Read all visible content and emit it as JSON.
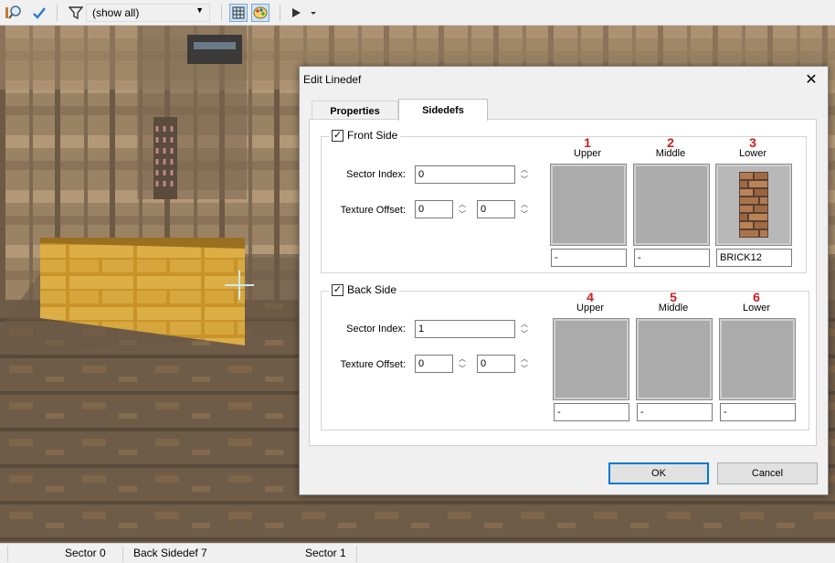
{
  "toolbar": {
    "filter_value": "(show all)",
    "icons": [
      "zoom-icon",
      "checkmark-icon",
      "filter-icon",
      "dropdown-arrow-icon",
      "grid-icon",
      "palette-icon",
      "play-icon"
    ]
  },
  "dialog": {
    "title": "Edit Linedef",
    "close_glyph": "✕",
    "tabs": [
      {
        "label": "Properties",
        "active": false
      },
      {
        "label": "Sidedefs",
        "active": true
      }
    ],
    "front": {
      "legend": "Front Side",
      "checked": true,
      "sector_index_label": "Sector Index:",
      "sector_index": "0",
      "texture_offset_label": "Texture Offset:",
      "offset_x": "0",
      "offset_y": "0",
      "textures": [
        {
          "num": "1",
          "caption": "Upper",
          "name": "-"
        },
        {
          "num": "2",
          "caption": "Middle",
          "name": "-"
        },
        {
          "num": "3",
          "caption": "Lower",
          "name": "BRICK12"
        }
      ]
    },
    "back": {
      "legend": "Back Side",
      "checked": true,
      "sector_index_label": "Sector Index:",
      "sector_index": "1",
      "texture_offset_label": "Texture Offset:",
      "offset_x": "0",
      "offset_y": "0",
      "textures": [
        {
          "num": "4",
          "caption": "Upper",
          "name": "-"
        },
        {
          "num": "5",
          "caption": "Middle",
          "name": "-"
        },
        {
          "num": "6",
          "caption": "Lower",
          "name": "-"
        }
      ]
    },
    "ok_label": "OK",
    "cancel_label": "Cancel"
  },
  "status": {
    "front_sector": "Sector 0",
    "back_sidedef": "Back Sidedef 7",
    "back_sector": "Sector 1"
  },
  "colors": {
    "texture_number": "#cc1f1f",
    "default_button_border": "#0078d7",
    "texture_swatch": "#ababab"
  }
}
